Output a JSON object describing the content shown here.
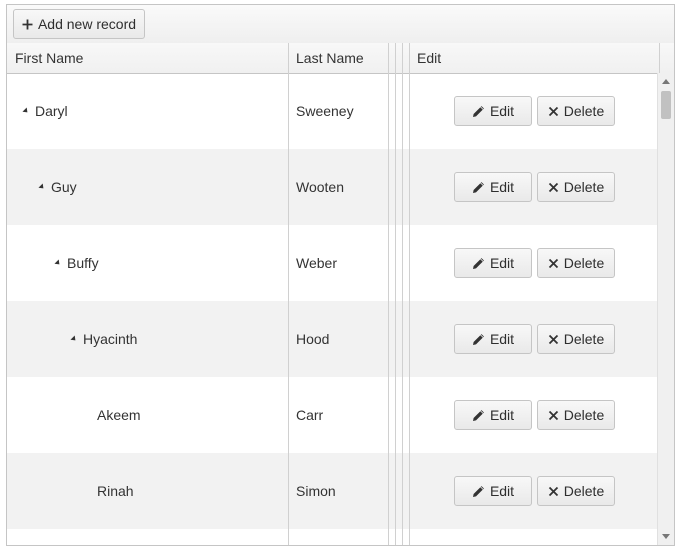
{
  "toolbar": {
    "add_label": "Add new record",
    "add_icon": "plus-icon"
  },
  "columns": {
    "first_name": "First Name",
    "last_name": "Last Name",
    "edit": "Edit"
  },
  "row_buttons": {
    "edit_label": "Edit",
    "delete_label": "Delete"
  },
  "rows": [
    {
      "first": "Daryl",
      "last": "Sweeney",
      "expanded": true
    },
    {
      "first": "Guy",
      "last": "Wooten",
      "expanded": true
    },
    {
      "first": "Buffy",
      "last": "Weber",
      "expanded": true
    },
    {
      "first": "Hyacinth",
      "last": "Hood",
      "expanded": true
    },
    {
      "first": "Akeem",
      "last": "Carr",
      "expanded": false
    },
    {
      "first": "Rinah",
      "last": "Simon",
      "expanded": false
    }
  ]
}
